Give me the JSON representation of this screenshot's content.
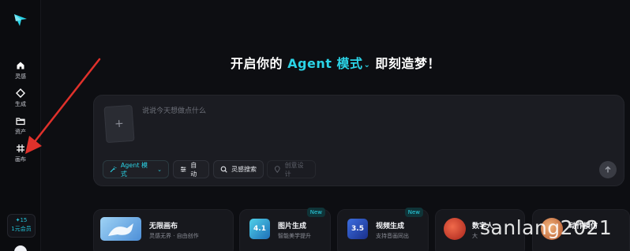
{
  "sidebar": {
    "items": [
      {
        "icon": "home-icon",
        "label": "灵感"
      },
      {
        "icon": "diamond-icon",
        "label": "生成"
      },
      {
        "icon": "folder-icon",
        "label": "资产"
      },
      {
        "icon": "canvas-icon",
        "label": "画布"
      }
    ],
    "credits": {
      "count": "✦15",
      "member": "1元会员"
    }
  },
  "headline": {
    "prefix": "开启你的",
    "mode": "Agent 模式",
    "suffix": "即刻造梦！"
  },
  "prompt": {
    "placeholder": "说说今天想做点什么",
    "chips": {
      "agent": "Agent 模式",
      "auto": "自动",
      "inspire": "灵感搜索",
      "design": "创意设计"
    }
  },
  "features": [
    {
      "title": "无限画布",
      "subtitle": "灵感无界 · 自由创作",
      "badge": ""
    },
    {
      "title": "图片生成",
      "subtitle": "智能美学提升",
      "badge": "New",
      "thumb_text": "4.1"
    },
    {
      "title": "视频生成",
      "subtitle": "支持音画同出",
      "badge": "New",
      "thumb_text": "3.5"
    },
    {
      "title": "数字人",
      "subtitle": "大",
      "badge": ""
    },
    {
      "title": "动作模仿",
      "subtitle": "",
      "badge": ""
    }
  ],
  "watermark": "sanlang2021",
  "colors": {
    "accent": "#2bd3e6",
    "background": "#0d0e12",
    "card": "#1b1c22",
    "arrow": "#e0312b"
  }
}
